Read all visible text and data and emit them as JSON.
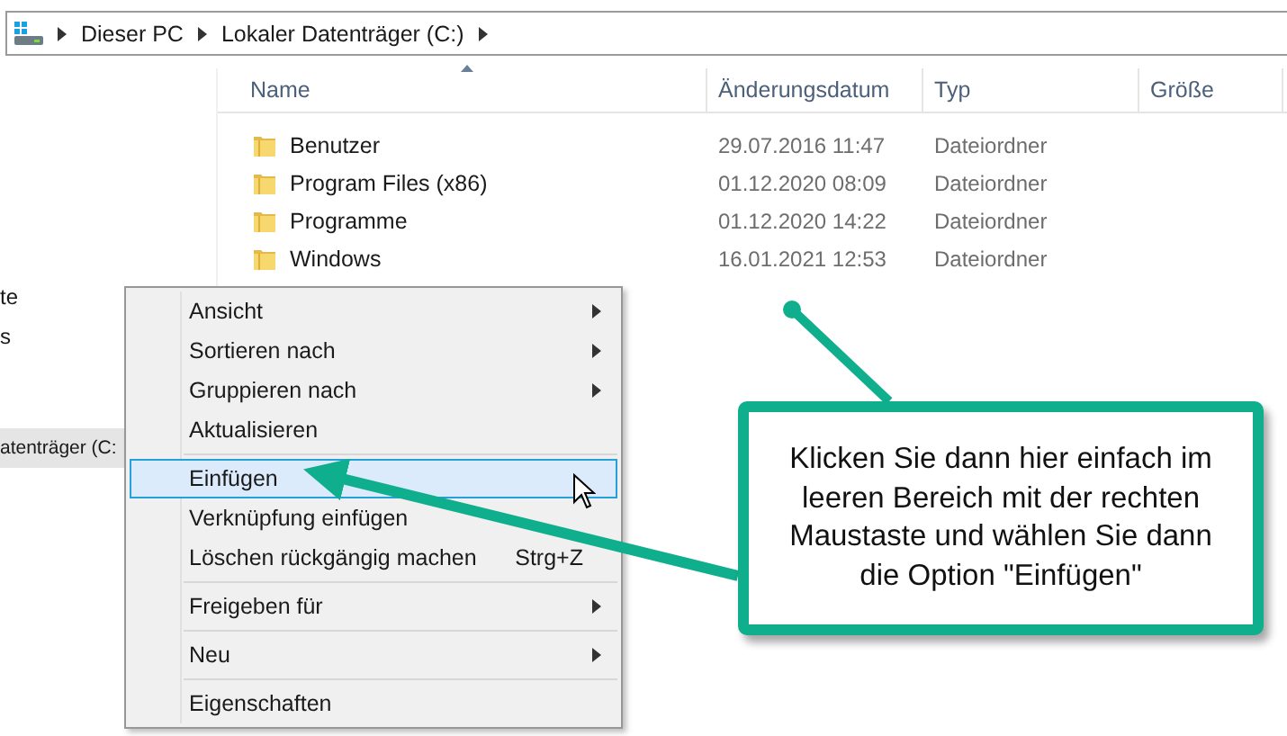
{
  "address_bar": {
    "crumbs": [
      "Dieser PC",
      "Lokaler Datenträger (C:)"
    ]
  },
  "nav_pane": {
    "items": [
      {
        "label": "te",
        "selected": false
      },
      {
        "label": "s",
        "selected": false
      },
      {
        "label": "atenträger (C:",
        "selected": true
      }
    ]
  },
  "file_list": {
    "columns": [
      {
        "label": "Name",
        "sorted": true
      },
      {
        "label": "Änderungsdatum",
        "sorted": false
      },
      {
        "label": "Typ",
        "sorted": false
      },
      {
        "label": "Größe",
        "sorted": false
      }
    ],
    "rows": [
      {
        "name": "Benutzer",
        "date": "29.07.2016 11:47",
        "type": "Dateiordner"
      },
      {
        "name": "Program Files (x86)",
        "date": "01.12.2020 08:09",
        "type": "Dateiordner"
      },
      {
        "name": "Programme",
        "date": "01.12.2020 14:22",
        "type": "Dateiordner"
      },
      {
        "name": "Windows",
        "date": "16.01.2021 12:53",
        "type": "Dateiordner"
      }
    ]
  },
  "context_menu": {
    "items": [
      {
        "kind": "item",
        "label": "Ansicht",
        "submenu": true,
        "selected": false
      },
      {
        "kind": "item",
        "label": "Sortieren nach",
        "submenu": true,
        "selected": false
      },
      {
        "kind": "item",
        "label": "Gruppieren nach",
        "submenu": true,
        "selected": false
      },
      {
        "kind": "item",
        "label": "Aktualisieren",
        "submenu": false,
        "selected": false
      },
      {
        "kind": "separator"
      },
      {
        "kind": "item",
        "label": "Einfügen",
        "submenu": false,
        "selected": true
      },
      {
        "kind": "item",
        "label": "Verknüpfung einfügen",
        "submenu": false,
        "selected": false
      },
      {
        "kind": "item",
        "label": "Löschen rückgängig machen",
        "shortcut": "Strg+Z",
        "submenu": false,
        "selected": false
      },
      {
        "kind": "separator"
      },
      {
        "kind": "item",
        "label": "Freigeben für",
        "submenu": true,
        "selected": false
      },
      {
        "kind": "separator"
      },
      {
        "kind": "item",
        "label": "Neu",
        "submenu": true,
        "selected": false
      },
      {
        "kind": "separator"
      },
      {
        "kind": "item",
        "label": "Eigenschaften",
        "submenu": false,
        "selected": false
      }
    ]
  },
  "callout": {
    "text": "Klicken Sie dann hier einfach im leeren Bereich mit der rechten Maustaste und wählen Sie dann die Option \"Einfügen\""
  }
}
